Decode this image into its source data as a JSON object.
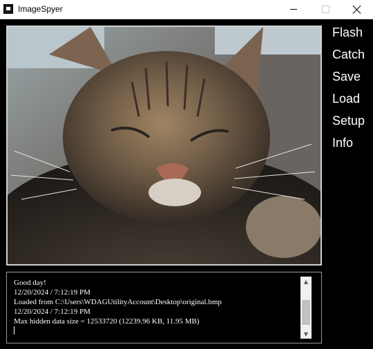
{
  "window": {
    "title": "ImageSpyer",
    "icon": "app-icon",
    "controls": [
      "minimize-icon",
      "maximize-icon",
      "close-icon"
    ]
  },
  "menu": {
    "items": [
      "Flash",
      "Catch",
      "Save",
      "Load",
      "Setup",
      "Info"
    ]
  },
  "log": {
    "lines": [
      "Good day!",
      "12/20/2024 / 7:12:19 PM",
      "Loaded from C:\\Users\\WDAGUtilityAccount\\Desktop\\original.bmp",
      "12/20/2024 / 7:12:19 PM",
      "Max hidden data size = 12533720 (12239.96 KB, 11.95 MB)"
    ]
  },
  "colors": {
    "background": "#000000",
    "titlebar": "#ffffff",
    "menu_text": "#ffffff",
    "log_text": "#ffffff"
  }
}
